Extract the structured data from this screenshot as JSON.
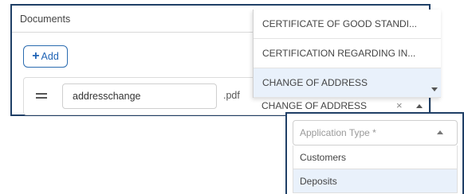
{
  "documents": {
    "title": "Documents",
    "add_label": "Add",
    "file_name": "addresschange",
    "file_ext": ".pdf",
    "doc_type_options": [
      "CERTIFICATE OF GOOD STANDI...",
      "CERTIFICATION REGARDING IN...",
      "CHANGE OF ADDRESS"
    ],
    "doc_type_selected": "CHANGE OF ADDRESS",
    "clear_symbol": "×"
  },
  "application_type": {
    "placeholder": "Application Type *",
    "options": [
      "Customers",
      "Deposits"
    ]
  },
  "colors": {
    "panel_border": "#1f3f66",
    "accent": "#1f63b5",
    "selected_bg": "#e9f1fb"
  }
}
